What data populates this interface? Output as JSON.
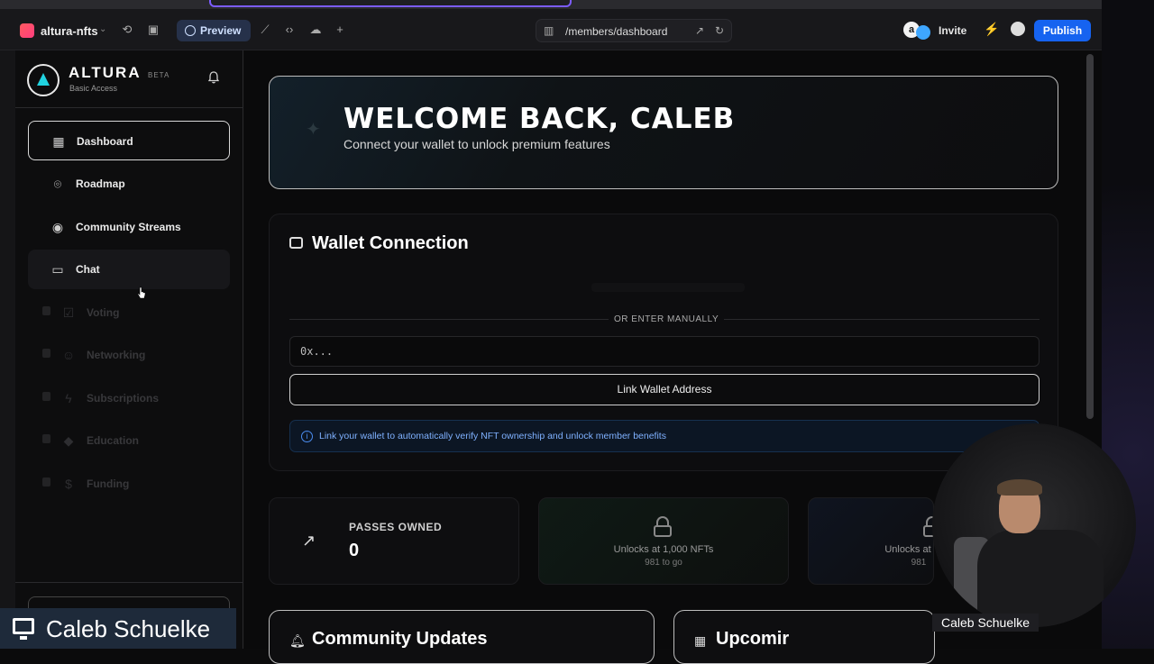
{
  "toolbar": {
    "project_name": "altura-nfts",
    "preview_label": "Preview",
    "route": "/members/dashboard",
    "invite_label": "Invite",
    "publish_label": "Publish",
    "avatar_letter": "a"
  },
  "sidebar": {
    "brand_name": "ALTURA",
    "brand_badge": "BETA",
    "access_level": "Basic Access",
    "items": [
      {
        "label": "Dashboard",
        "icon": "grid-icon",
        "state": "active"
      },
      {
        "label": "Roadmap",
        "icon": "map-pin-icon",
        "state": "normal"
      },
      {
        "label": "Community Streams",
        "icon": "broadcast-icon",
        "state": "normal"
      },
      {
        "label": "Chat",
        "icon": "chat-bubble-icon",
        "state": "hover"
      },
      {
        "label": "Voting",
        "icon": "checkbox-icon",
        "state": "locked"
      },
      {
        "label": "Networking",
        "icon": "users-icon",
        "state": "locked"
      },
      {
        "label": "Subscriptions",
        "icon": "bolt-icon",
        "state": "locked"
      },
      {
        "label": "Education",
        "icon": "graduation-cap-icon",
        "state": "locked"
      },
      {
        "label": "Funding",
        "icon": "dollar-icon",
        "state": "locked"
      }
    ]
  },
  "welcome": {
    "title": "WELCOME BACK, CALEB",
    "subtitle": "Connect your wallet to unlock premium features"
  },
  "wallet": {
    "title": "Wallet Connection",
    "divider_label": "OR ENTER MANUALLY",
    "address_placeholder": "0x...",
    "link_button": "Link Wallet Address",
    "info_text": "Link your wallet to automatically verify NFT ownership and unlock member benefits"
  },
  "stats": [
    {
      "label": "PASSES OWNED",
      "value": "0"
    },
    {
      "unlock_text": "Unlocks at 1,000 NFTs",
      "remaining": "981 to go"
    },
    {
      "unlock_text": "Unlocks at",
      "remaining": "981"
    }
  ],
  "sections": {
    "community_updates": "Community Updates",
    "upcoming": "Upcomir"
  },
  "overlay": {
    "cam_name": "Caleb Schuelke",
    "presenter_name": "Caleb Schuelke"
  },
  "colors": {
    "accent": "#1663f0",
    "bolt": "#2de07a",
    "brand_teal": "#21d3e0",
    "info_blue": "#7fb1ff"
  }
}
